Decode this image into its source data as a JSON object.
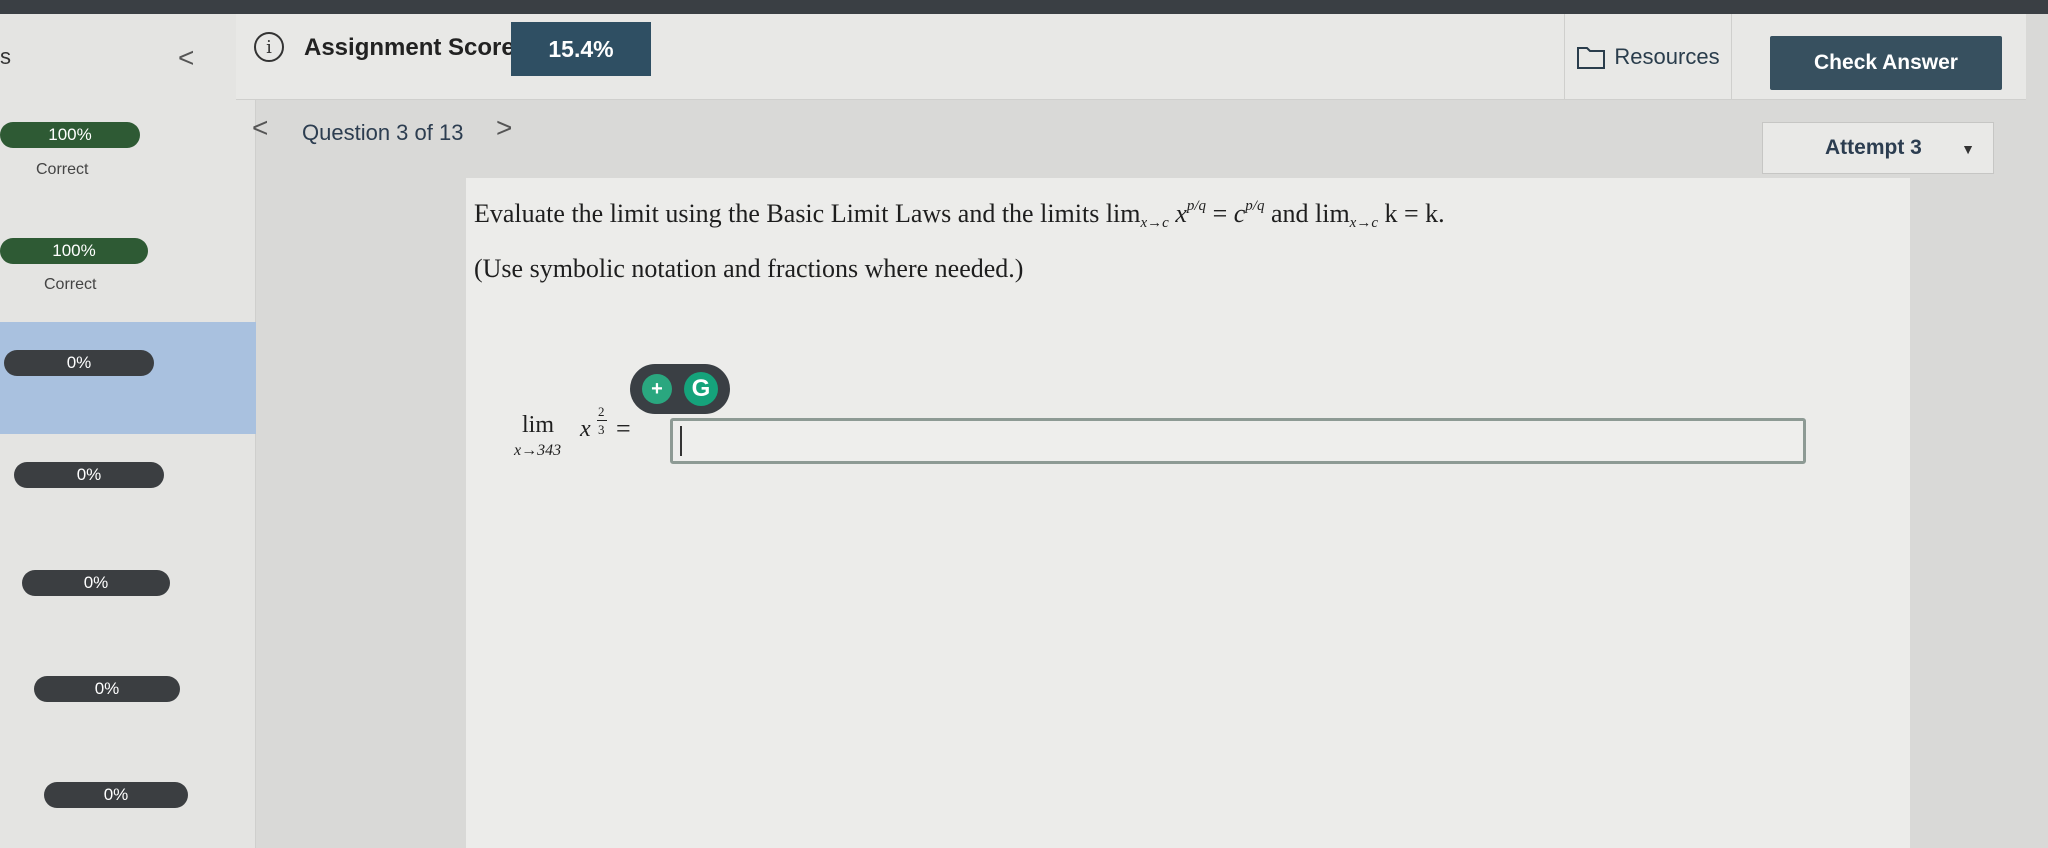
{
  "sidebar": {
    "head_text": "s",
    "collapse_glyph": "<",
    "items": [
      {
        "percent": "100%",
        "status": "Correct"
      },
      {
        "percent": "100%",
        "status": "Correct"
      },
      {
        "percent": "0%"
      },
      {
        "percent": "0%"
      },
      {
        "percent": "0%"
      },
      {
        "percent": "0%"
      },
      {
        "percent": "0%"
      }
    ]
  },
  "header": {
    "info_icon": "i",
    "score_label": "Assignment Score:",
    "score_value": "15.4%",
    "resources_label": "Resources",
    "check_answer_label": "Check Answer"
  },
  "question_nav": {
    "prev_glyph": "<",
    "label": "Question 3 of 13",
    "next_glyph": ">",
    "attempt_label": "Attempt 3"
  },
  "question": {
    "prompt_start": "Evaluate the limit using the Basic Limit Laws and the limits lim",
    "sub1": "x→c",
    "var_x": "x",
    "sup1": "p/q",
    "eq": " = ",
    "var_c": "c",
    "sup2": "p/q",
    "and_lim": " and lim",
    "sub2": "x→c",
    "tail": " k = k.",
    "hint": "(Use symbolic notation and fractions where needed.)",
    "lim_word": "lim",
    "lim_sub": "x→343",
    "lim_base": "x",
    "exp_num": "2",
    "exp_den": "3",
    "equals": "=",
    "answer_value": ""
  },
  "grammarly": {
    "plus": "+",
    "logo": "G"
  },
  "colors": {
    "score_box": "#2f4f63",
    "check_button": "#37505f",
    "pill_correct": "#2e5a34",
    "pill_default": "#3b3e41",
    "active_row": "#a9c1df"
  }
}
